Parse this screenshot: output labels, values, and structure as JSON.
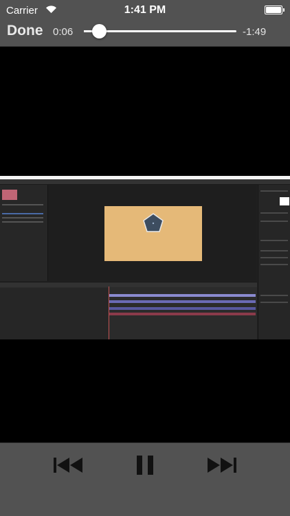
{
  "status_bar": {
    "carrier": "Carrier",
    "time": "1:41 PM",
    "battery_level": 1.0
  },
  "player": {
    "done_label": "Done",
    "elapsed": "0:06",
    "remaining": "-1:49",
    "progress_fraction": 0.1
  },
  "controls": {
    "previous_icon": "skip-back-icon",
    "pause_icon": "pause-icon",
    "next_icon": "skip-forward-icon"
  },
  "colors": {
    "bar_background": "#525252",
    "composition_background": "#e5b978",
    "shape_fill": "#3d4d60"
  }
}
